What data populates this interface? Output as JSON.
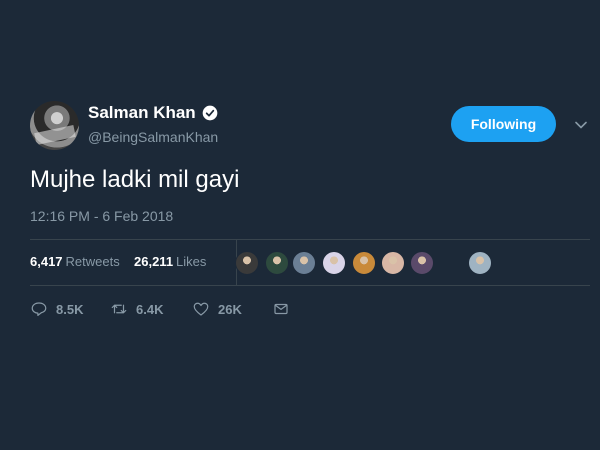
{
  "user": {
    "display_name": "Salman Khan",
    "handle": "@BeingSalmanKhan",
    "verified": true
  },
  "follow_button": {
    "label": "Following"
  },
  "tweet": {
    "text": "Mujhe ladki mil gayi",
    "timestamp": "12:16 PM - 6 Feb 2018"
  },
  "stats": {
    "retweets_count": "6,417",
    "retweets_label": "Retweets",
    "likes_count": "26,211",
    "likes_label": "Likes"
  },
  "likers": [
    {
      "color": "#3a3a3a"
    },
    {
      "color": "#2d4a3e"
    },
    {
      "color": "#6b7f95"
    },
    {
      "color": "#d9d4e8"
    },
    {
      "color": "#c98a3a"
    },
    {
      "color": "#d8b7a6"
    },
    {
      "color": "#5a4a6a"
    },
    {
      "color": "#9fb3c2"
    }
  ],
  "actions": {
    "reply_count": "8.5K",
    "retweet_count": "6.4K",
    "like_count": "26K"
  },
  "colors": {
    "background": "#1c2938",
    "accent": "#1da1f2",
    "secondary_text": "#8899a6",
    "divider": "#38444d"
  }
}
